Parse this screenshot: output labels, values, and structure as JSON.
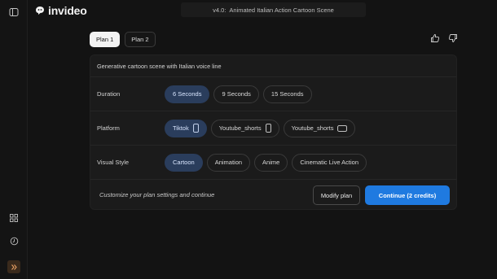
{
  "app": {
    "brand": "invideo",
    "title_version": "v4.0:",
    "title_text": "Animated Italian Action Cartoon Scene"
  },
  "colors": {
    "accent": "#1f7ae0",
    "selected_chip": "#2a3d5c",
    "background": "#131313",
    "card": "#1b1b1b"
  },
  "plans": {
    "tabs": [
      {
        "label": "Plan 1",
        "active": true
      },
      {
        "label": "Plan 2",
        "active": false
      }
    ]
  },
  "feedback": {
    "icons": [
      "thumbs-up-icon",
      "thumbs-down-icon"
    ]
  },
  "card": {
    "description": "Generative cartoon scene with Italian voice line",
    "rows": [
      {
        "label": "Duration",
        "options": [
          {
            "label": "6 Seconds",
            "selected": true
          },
          {
            "label": "9 Seconds",
            "selected": false
          },
          {
            "label": "15 Seconds",
            "selected": false
          }
        ]
      },
      {
        "label": "Platform",
        "options": [
          {
            "label": "Tiktok",
            "selected": true,
            "icon": "portrait-phone-icon"
          },
          {
            "label": "Youtube_shorts",
            "selected": false,
            "icon": "portrait-phone-icon"
          },
          {
            "label": "Youtube_shorts",
            "selected": false,
            "icon": "landscape-screen-icon"
          }
        ]
      },
      {
        "label": "Visual Style",
        "options": [
          {
            "label": "Cartoon",
            "selected": true
          },
          {
            "label": "Animation",
            "selected": false
          },
          {
            "label": "Anime",
            "selected": false
          },
          {
            "label": "Cinematic Live Action",
            "selected": false
          }
        ]
      }
    ],
    "footer": {
      "hint": "Customize your plan settings and continue",
      "modify_label": "Modify plan",
      "continue_label": "Continue (2 credits)"
    }
  },
  "rail": {
    "icons": [
      "sidebar-toggle-icon",
      "grid-icon",
      "history-icon",
      "expand-icon"
    ]
  }
}
